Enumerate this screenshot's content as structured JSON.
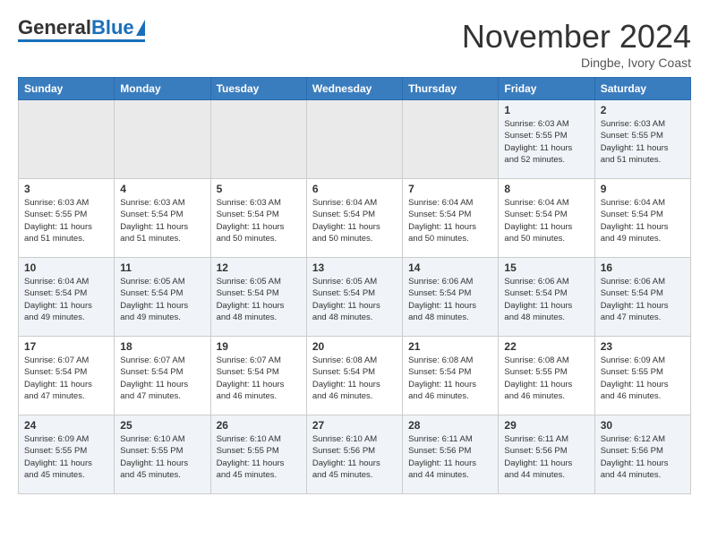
{
  "header": {
    "logo_general": "General",
    "logo_blue": "Blue",
    "month_title": "November 2024",
    "location": "Dingbe, Ivory Coast"
  },
  "weekdays": [
    "Sunday",
    "Monday",
    "Tuesday",
    "Wednesday",
    "Thursday",
    "Friday",
    "Saturday"
  ],
  "weeks": [
    [
      {
        "day": "",
        "info": ""
      },
      {
        "day": "",
        "info": ""
      },
      {
        "day": "",
        "info": ""
      },
      {
        "day": "",
        "info": ""
      },
      {
        "day": "",
        "info": ""
      },
      {
        "day": "1",
        "info": "Sunrise: 6:03 AM\nSunset: 5:55 PM\nDaylight: 11 hours\nand 52 minutes."
      },
      {
        "day": "2",
        "info": "Sunrise: 6:03 AM\nSunset: 5:55 PM\nDaylight: 11 hours\nand 51 minutes."
      }
    ],
    [
      {
        "day": "3",
        "info": "Sunrise: 6:03 AM\nSunset: 5:55 PM\nDaylight: 11 hours\nand 51 minutes."
      },
      {
        "day": "4",
        "info": "Sunrise: 6:03 AM\nSunset: 5:54 PM\nDaylight: 11 hours\nand 51 minutes."
      },
      {
        "day": "5",
        "info": "Sunrise: 6:03 AM\nSunset: 5:54 PM\nDaylight: 11 hours\nand 50 minutes."
      },
      {
        "day": "6",
        "info": "Sunrise: 6:04 AM\nSunset: 5:54 PM\nDaylight: 11 hours\nand 50 minutes."
      },
      {
        "day": "7",
        "info": "Sunrise: 6:04 AM\nSunset: 5:54 PM\nDaylight: 11 hours\nand 50 minutes."
      },
      {
        "day": "8",
        "info": "Sunrise: 6:04 AM\nSunset: 5:54 PM\nDaylight: 11 hours\nand 50 minutes."
      },
      {
        "day": "9",
        "info": "Sunrise: 6:04 AM\nSunset: 5:54 PM\nDaylight: 11 hours\nand 49 minutes."
      }
    ],
    [
      {
        "day": "10",
        "info": "Sunrise: 6:04 AM\nSunset: 5:54 PM\nDaylight: 11 hours\nand 49 minutes."
      },
      {
        "day": "11",
        "info": "Sunrise: 6:05 AM\nSunset: 5:54 PM\nDaylight: 11 hours\nand 49 minutes."
      },
      {
        "day": "12",
        "info": "Sunrise: 6:05 AM\nSunset: 5:54 PM\nDaylight: 11 hours\nand 48 minutes."
      },
      {
        "day": "13",
        "info": "Sunrise: 6:05 AM\nSunset: 5:54 PM\nDaylight: 11 hours\nand 48 minutes."
      },
      {
        "day": "14",
        "info": "Sunrise: 6:06 AM\nSunset: 5:54 PM\nDaylight: 11 hours\nand 48 minutes."
      },
      {
        "day": "15",
        "info": "Sunrise: 6:06 AM\nSunset: 5:54 PM\nDaylight: 11 hours\nand 48 minutes."
      },
      {
        "day": "16",
        "info": "Sunrise: 6:06 AM\nSunset: 5:54 PM\nDaylight: 11 hours\nand 47 minutes."
      }
    ],
    [
      {
        "day": "17",
        "info": "Sunrise: 6:07 AM\nSunset: 5:54 PM\nDaylight: 11 hours\nand 47 minutes."
      },
      {
        "day": "18",
        "info": "Sunrise: 6:07 AM\nSunset: 5:54 PM\nDaylight: 11 hours\nand 47 minutes."
      },
      {
        "day": "19",
        "info": "Sunrise: 6:07 AM\nSunset: 5:54 PM\nDaylight: 11 hours\nand 46 minutes."
      },
      {
        "day": "20",
        "info": "Sunrise: 6:08 AM\nSunset: 5:54 PM\nDaylight: 11 hours\nand 46 minutes."
      },
      {
        "day": "21",
        "info": "Sunrise: 6:08 AM\nSunset: 5:54 PM\nDaylight: 11 hours\nand 46 minutes."
      },
      {
        "day": "22",
        "info": "Sunrise: 6:08 AM\nSunset: 5:55 PM\nDaylight: 11 hours\nand 46 minutes."
      },
      {
        "day": "23",
        "info": "Sunrise: 6:09 AM\nSunset: 5:55 PM\nDaylight: 11 hours\nand 46 minutes."
      }
    ],
    [
      {
        "day": "24",
        "info": "Sunrise: 6:09 AM\nSunset: 5:55 PM\nDaylight: 11 hours\nand 45 minutes."
      },
      {
        "day": "25",
        "info": "Sunrise: 6:10 AM\nSunset: 5:55 PM\nDaylight: 11 hours\nand 45 minutes."
      },
      {
        "day": "26",
        "info": "Sunrise: 6:10 AM\nSunset: 5:55 PM\nDaylight: 11 hours\nand 45 minutes."
      },
      {
        "day": "27",
        "info": "Sunrise: 6:10 AM\nSunset: 5:56 PM\nDaylight: 11 hours\nand 45 minutes."
      },
      {
        "day": "28",
        "info": "Sunrise: 6:11 AM\nSunset: 5:56 PM\nDaylight: 11 hours\nand 44 minutes."
      },
      {
        "day": "29",
        "info": "Sunrise: 6:11 AM\nSunset: 5:56 PM\nDaylight: 11 hours\nand 44 minutes."
      },
      {
        "day": "30",
        "info": "Sunrise: 6:12 AM\nSunset: 5:56 PM\nDaylight: 11 hours\nand 44 minutes."
      }
    ]
  ]
}
